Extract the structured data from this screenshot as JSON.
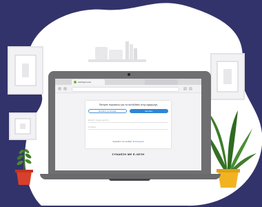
{
  "colors": {
    "background": "#33336b",
    "blob": "#ffffff",
    "laptop": "#6f6f72",
    "accent_blue": "#2e86d6",
    "plant_green": "#3f7a2a",
    "pot_red": "#d9402b",
    "pot_yellow": "#f2b321"
  },
  "browser": {
    "tab_title": "Ακαδημία plus",
    "tab_icon": "site-favicon-icon"
  },
  "login": {
    "heading": "Πατήστε παρακάτω για να συνδεθείτε στην εφαρμογή",
    "google_button": "Είσοδος με Google",
    "signin_button": "Είσοδος",
    "email_placeholder": "Email ή όνομα χρήστη",
    "password_placeholder": "Κωδικός",
    "footer_text": "Ξεχάσατε τον κωδικό;",
    "footer_link": "Επαναφορά"
  },
  "caption": "ΣΥΝΔΕΣΗ ΜΕ Ε-ΛΕΞΗ",
  "icons": [
    "picture-frame-icon",
    "shelf-icon",
    "potted-plant-icon",
    "camera-icon"
  ]
}
